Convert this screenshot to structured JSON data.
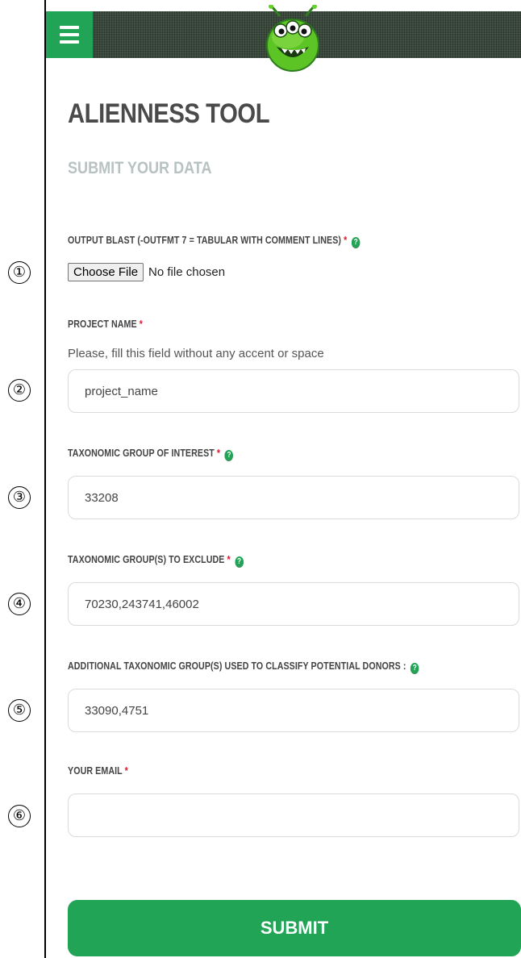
{
  "header": {
    "menu_icon": "hamburger-icon",
    "logo": "alien-logo",
    "colors": {
      "bar": "#3a4a3c",
      "accent": "#21a455"
    }
  },
  "page": {
    "title": "ALIENNESS TOOL",
    "subtitle": "SUBMIT YOUR DATA"
  },
  "form": {
    "blast": {
      "label": "OUTPUT BLAST (-OUTFMT 7 = TABULAR WITH COMMENT LINES)",
      "required": "*",
      "help": "?",
      "button": "Choose File",
      "status": "No file chosen"
    },
    "project": {
      "label": "PROJECT NAME",
      "required": "*",
      "hint": "Please, fill this field without any accent or space",
      "value": "project_name"
    },
    "interest": {
      "label": "TAXONOMIC GROUP OF INTEREST",
      "required": "*",
      "help": "?",
      "value": "33208"
    },
    "exclude": {
      "label": "TAXONOMIC GROUP(S) TO EXCLUDE",
      "required": "*",
      "help": "?",
      "value": "70230,243741,46002"
    },
    "donors": {
      "label": "ADDITIONAL TAXONOMIC GROUP(S) USED TO CLASSIFY POTENTIAL DONORS :",
      "help": "?",
      "value": "33090,4751"
    },
    "email": {
      "label": "YOUR EMAIL",
      "required": "*",
      "value": ""
    },
    "submit": "SUBMIT"
  },
  "annotations": [
    "①",
    "②",
    "③",
    "④",
    "⑤",
    "⑥"
  ]
}
